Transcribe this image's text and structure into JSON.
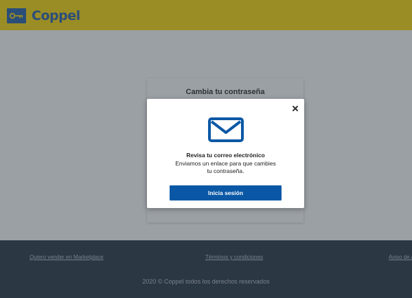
{
  "header": {
    "brand_name": "Coppel",
    "logo_icon": "key-icon",
    "background_color": "#ffd800",
    "brand_color": "#1f5aa6"
  },
  "main": {
    "card_title": "Cambia tu contraseña"
  },
  "modal": {
    "close_icon": "close-icon",
    "mail_icon": "envelope-icon",
    "title": "Revisa tu correo electrónico",
    "body_line1": "Enviamos un enlace para que cambies",
    "body_line2": "tu contraseña.",
    "button_label": "Inicia sesión",
    "button_color": "#0a58a5"
  },
  "footer": {
    "link_marketplace": "Quiero vender en Marketplace",
    "link_terms": "Términos y condiciones",
    "link_privacy": "Aviso de A",
    "copyright": "2020 © Coppel todos los derechos reservados",
    "background_color": "#1e2c3a"
  }
}
